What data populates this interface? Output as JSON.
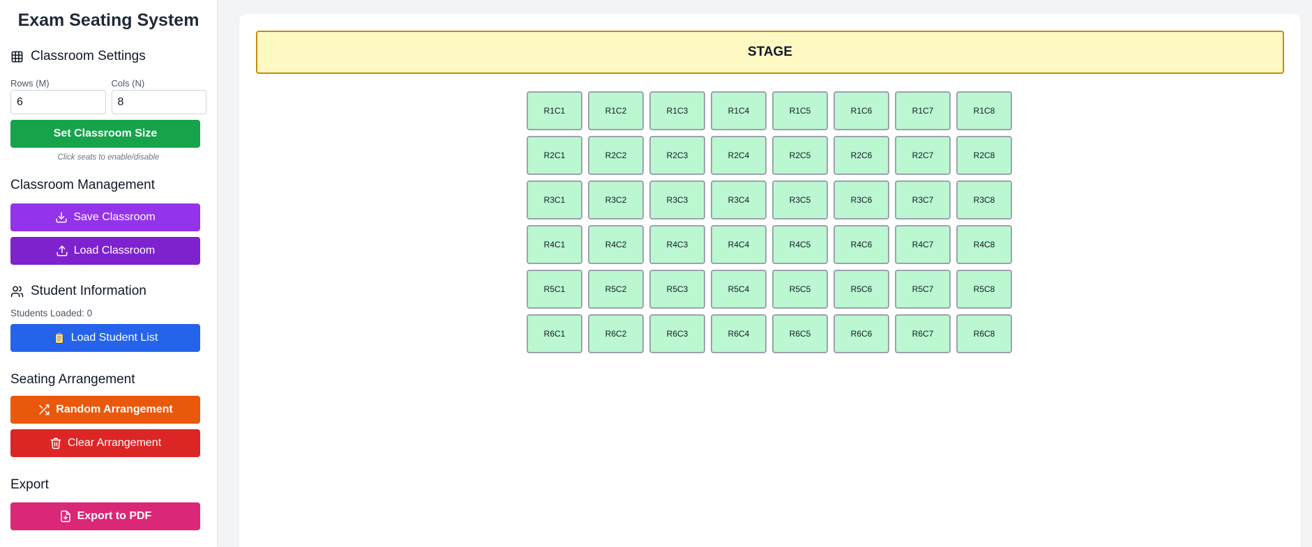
{
  "app": {
    "title": "Exam Seating System"
  },
  "classroom_settings": {
    "heading": "Classroom Settings",
    "icon": "table-grid-icon",
    "rows_label": "Rows (M)",
    "rows_value": "6",
    "cols_label": "Cols (N)",
    "cols_value": "8",
    "set_size_button": "Set Classroom Size",
    "hint": "Click seats to enable/disable"
  },
  "classroom_management": {
    "heading": "Classroom Management",
    "save_button": "Save Classroom",
    "load_button": "Load Classroom"
  },
  "student_information": {
    "heading": "Student Information",
    "icon": "users-icon",
    "students_loaded": "Students Loaded: 0",
    "load_button": "Load Student List"
  },
  "seating_arrangement": {
    "heading": "Seating Arrangement",
    "random_button": "Random Arrangement",
    "clear_button": "Clear Arrangement"
  },
  "export": {
    "heading": "Export",
    "pdf_button": "Export to PDF"
  },
  "stage": {
    "label": "STAGE"
  },
  "seats": [
    [
      "R1C1",
      "R1C2",
      "R1C3",
      "R1C4",
      "R1C5",
      "R1C6",
      "R1C7",
      "R1C8"
    ],
    [
      "R2C1",
      "R2C2",
      "R2C3",
      "R2C4",
      "R2C5",
      "R2C6",
      "R2C7",
      "R2C8"
    ],
    [
      "R3C1",
      "R3C2",
      "R3C3",
      "R3C4",
      "R3C5",
      "R3C6",
      "R3C7",
      "R3C8"
    ],
    [
      "R4C1",
      "R4C2",
      "R4C3",
      "R4C4",
      "R4C5",
      "R4C6",
      "R4C7",
      "R4C8"
    ],
    [
      "R5C1",
      "R5C2",
      "R5C3",
      "R5C4",
      "R5C5",
      "R5C6",
      "R5C7",
      "R5C8"
    ],
    [
      "R6C1",
      "R6C2",
      "R6C3",
      "R6C4",
      "R6C5",
      "R6C6",
      "R6C7",
      "R6C8"
    ]
  ],
  "colors": {
    "green_button": "#16a34a",
    "purple_light": "#9333ea",
    "purple_dark": "#7e22ce",
    "blue_button": "#2563eb",
    "orange_button": "#ea580c",
    "red_button": "#dc2626",
    "pink_button": "#db2777",
    "seat_fill": "#bbf7d0",
    "stage_fill": "#fef9c3",
    "stage_border": "#ca8a04"
  }
}
